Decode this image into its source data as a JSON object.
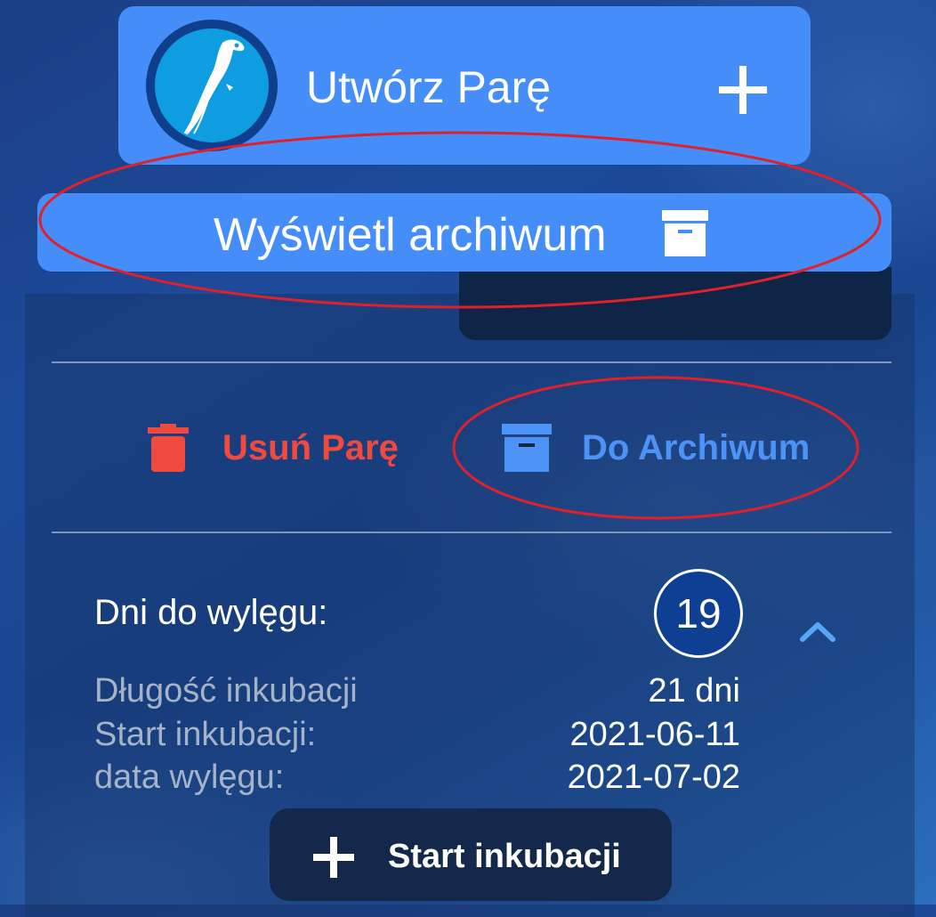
{
  "create_card": {
    "label": "Utwórz Parę",
    "avatar_icon": "parrot-icon",
    "add_icon": "plus-icon"
  },
  "archive_button": {
    "label": "Wyświetl archiwum",
    "icon": "archive-box-icon"
  },
  "actions": {
    "delete_label": "Usuń Parę",
    "delete_icon": "trash-icon",
    "delete_color": "#f04a3e",
    "archive_label": "Do Archiwum",
    "archive_icon": "archive-box-icon",
    "archive_color": "#4d92f6"
  },
  "hatch": {
    "label": "Dni do wylęgu:",
    "days": "19",
    "collapse_icon": "chevron-up-icon"
  },
  "incubation": {
    "rows": [
      {
        "label": "Długość inkubacji",
        "value": "21 dni"
      },
      {
        "label": "Start inkubacji:",
        "value": "2021-06-11"
      },
      {
        "label": "data wylęgu:",
        "value": "2021-07-02"
      }
    ]
  },
  "start_button": {
    "label": "Start inkubacji",
    "icon": "plus-icon"
  },
  "colors": {
    "accent_blue": "#458df8",
    "annotation_red": "#e0202a",
    "dark_navy": "#13284b"
  }
}
